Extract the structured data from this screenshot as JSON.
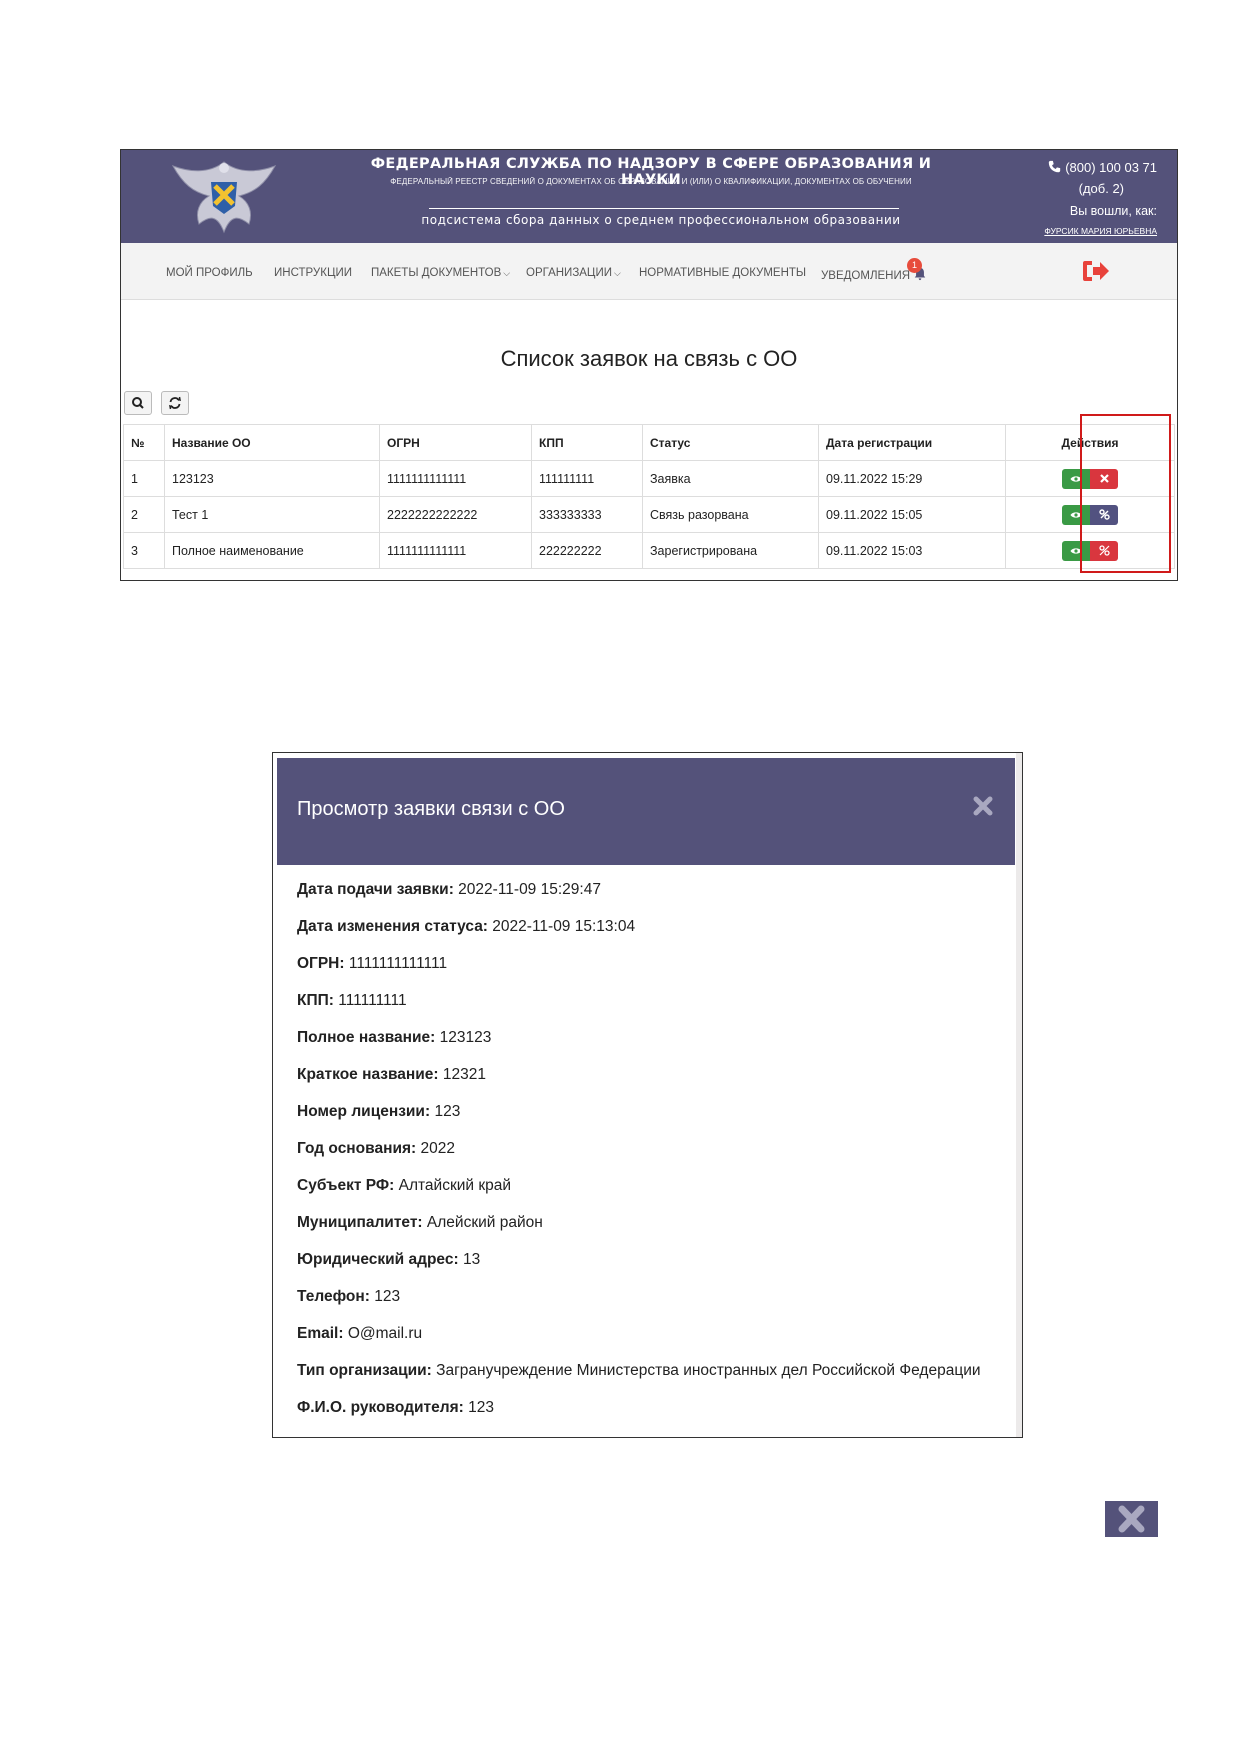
{
  "header": {
    "org_title": "ФЕДЕРАЛЬНАЯ СЛУЖБА ПО НАДЗОРУ В СФЕРЕ ОБРАЗОВАНИЯ И НАУКИ",
    "org_subtitle": "ФЕДЕРАЛЬНЫЙ РЕЕСТР СВЕДЕНИЙ О ДОКУМЕНТАХ ОБ ОБРАЗОВАНИИ И (ИЛИ) О КВАЛИФИКАЦИИ, ДОКУМЕНТАХ ОБ ОБУЧЕНИИ",
    "subsystem": "подсистема сбора данных о среднем профессиональном образовании",
    "phone": "(800) 100 03 71",
    "phone_ext": "(доб. 2)",
    "logged_in_label": "Вы вошли, как:",
    "user_name": "ФУРСИК МАРИЯ ЮРЬЕВНА"
  },
  "nav": {
    "items": [
      {
        "label": "МОЙ ПРОФИЛЬ"
      },
      {
        "label": "ИНСТРУКЦИИ"
      },
      {
        "label": "ПАКЕТЫ ДОКУМЕНТОВ"
      },
      {
        "label": "ОРГАНИЗАЦИИ"
      },
      {
        "label": "НОРМАТИВНЫЕ ДОКУМЕНТЫ"
      },
      {
        "label": "УВЕДОМЛЕНИЯ"
      }
    ],
    "notification_count": "1"
  },
  "list": {
    "title": "Список заявок на связь с ОО",
    "columns": [
      "№",
      "Название ОО",
      "ОГРН",
      "КПП",
      "Статус",
      "Дата регистрации",
      "Действия"
    ],
    "rows": [
      {
        "num": "1",
        "name": "123123",
        "ogrn": "1111111111111",
        "kpp": "111111111",
        "status": "Заявка",
        "date": "09.11.2022 15:29",
        "second_action": "delete"
      },
      {
        "num": "2",
        "name": "Тест 1",
        "ogrn": "2222222222222",
        "kpp": "333333333",
        "status": "Связь разорвана",
        "date": "09.11.2022 15:05",
        "second_action": "link"
      },
      {
        "num": "3",
        "name": "Полное наименование",
        "ogrn": "1111111111111",
        "kpp": "222222222",
        "status": "Зарегистрирована",
        "date": "09.11.2022 15:03",
        "second_action": "unlink"
      }
    ]
  },
  "modal": {
    "title": "Просмотр заявки связи с ОО",
    "fields": [
      {
        "label": "Дата подачи заявки:",
        "value": "2022-11-09 15:29:47"
      },
      {
        "label": "Дата изменения статуса:",
        "value": "2022-11-09 15:13:04"
      },
      {
        "label": "ОГРН:",
        "value": "1111111111111"
      },
      {
        "label": "КПП:",
        "value": "111111111"
      },
      {
        "label": "Полное название:",
        "value": "123123"
      },
      {
        "label": "Краткое название:",
        "value": "12321"
      },
      {
        "label": "Номер лицензии:",
        "value": "123"
      },
      {
        "label": "Год основания:",
        "value": "2022"
      },
      {
        "label": "Субъект РФ:",
        "value": "Алтайский край"
      },
      {
        "label": "Муниципалитет:",
        "value": "Алейский район"
      },
      {
        "label": "Юридический адрес:",
        "value": "13"
      },
      {
        "label": "Телефон:",
        "value": "123"
      },
      {
        "label": "Email:",
        "value": "O@mail.ru"
      },
      {
        "label": "Тип организации:",
        "value": "Загранучреждение Министерства иностранных дел Российской Федерации"
      },
      {
        "label": "Ф.И.О. руководителя:",
        "value": "123"
      }
    ]
  },
  "colors": {
    "brand": "#54527a",
    "view_button": "#3a9a45",
    "delete_button": "#d9363e",
    "highlight": "#d01a1a"
  }
}
